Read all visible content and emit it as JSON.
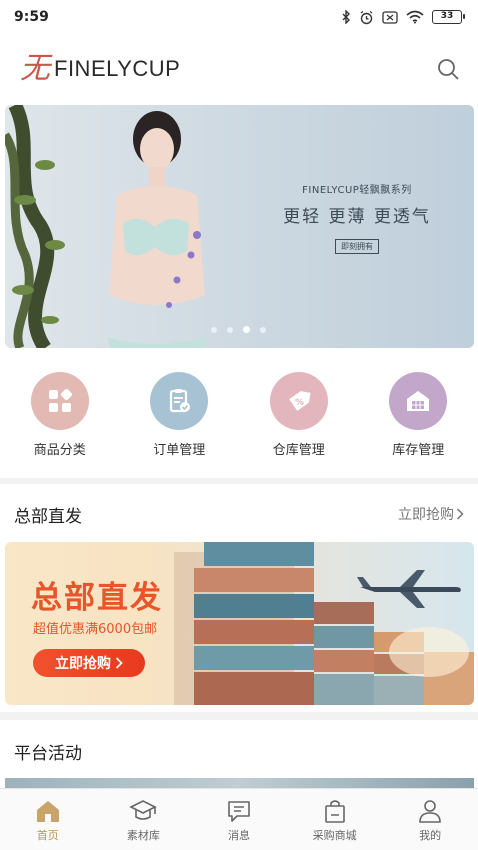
{
  "status_bar": {
    "time": "9:59",
    "battery": "33",
    "icons": [
      "bluetooth-icon",
      "alarm-icon",
      "sim-icon",
      "wifi-icon",
      "battery-icon"
    ]
  },
  "header": {
    "logo_mark": "无",
    "logo_text": "FINELYCUP",
    "search_icon": "search-icon"
  },
  "banner": {
    "series": "FINELYCUP轻飘飘系列",
    "tagline": "更轻  更薄  更透气",
    "button": "即刻拥有",
    "slide_count": 4,
    "active_slide": 3
  },
  "quick_nav": [
    {
      "label": "商品分类",
      "icon": "category-grid-icon",
      "color": "#e2b9b3"
    },
    {
      "label": "订单管理",
      "icon": "clipboard-check-icon",
      "color": "#a7c3d3"
    },
    {
      "label": "仓库管理",
      "icon": "discount-tag-icon",
      "color": "#e3b6bd"
    },
    {
      "label": "库存管理",
      "icon": "warehouse-icon",
      "color": "#c3a7cb"
    }
  ],
  "hq_section": {
    "title": "总部直发",
    "more": "立即抢购"
  },
  "promo": {
    "title": "总部直发",
    "subtitle": "超值优惠满6000包邮",
    "button": "立即抢购"
  },
  "activity_section": {
    "title": "平台活动"
  },
  "tab_bar": [
    {
      "label": "首页",
      "icon": "home-icon",
      "active": true
    },
    {
      "label": "素材库",
      "icon": "graduation-cap-icon",
      "active": false
    },
    {
      "label": "消息",
      "icon": "message-icon",
      "active": false
    },
    {
      "label": "采购商城",
      "icon": "shopping-bag-icon",
      "active": false
    },
    {
      "label": "我的",
      "icon": "profile-icon",
      "active": false
    }
  ],
  "colors": {
    "accent": "#b8945a",
    "promo_red": "#e8552a"
  }
}
